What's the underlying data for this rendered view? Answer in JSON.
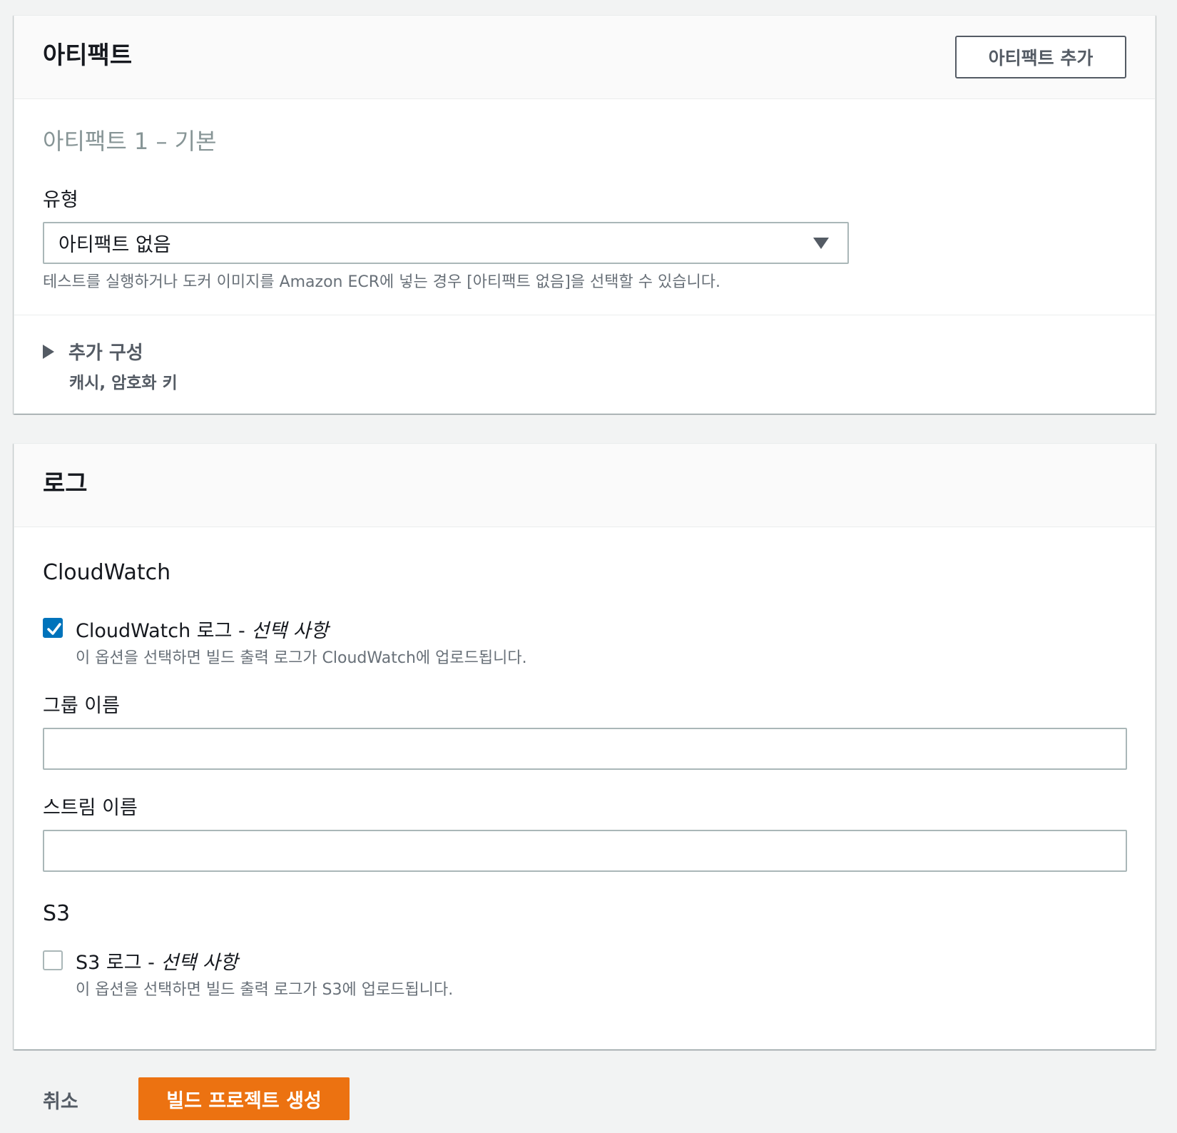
{
  "artifacts": {
    "title": "아티팩트",
    "add_button": "아티팩트 추가",
    "item_heading": "아티팩트 1 – 기본",
    "type_label": "유형",
    "type_value": "아티팩트 없음",
    "type_description": "테스트를 실행하거나 도커 이미지를 Amazon ECR에 넣는 경우 [아티팩트 없음]을 선택할 수 있습니다.",
    "additional_config": {
      "title": "추가 구성",
      "subtitle": "캐시, 암호화 키",
      "expanded": false
    }
  },
  "logs": {
    "title": "로그",
    "cloudwatch": {
      "section_title": "CloudWatch",
      "checkbox_label": "CloudWatch 로그 - ",
      "checkbox_optional": "선택 사항",
      "checked": true,
      "checkbox_description": "이 옵션을 선택하면 빌드 출력 로그가 CloudWatch에 업로드됩니다.",
      "group_label": "그룹 이름",
      "group_value": "",
      "stream_label": "스트림 이름",
      "stream_value": ""
    },
    "s3": {
      "section_title": "S3",
      "checkbox_label": "S3 로그 - ",
      "checkbox_optional": "선택 사항",
      "checked": false,
      "checkbox_description": "이 옵션을 선택하면 빌드 출력 로그가 S3에 업로드됩니다."
    }
  },
  "footer": {
    "cancel": "취소",
    "create": "빌드 프로젝트 생성"
  },
  "colors": {
    "primary": "#ec7211",
    "checkbox": "#0073bb",
    "background": "#f2f3f3"
  }
}
